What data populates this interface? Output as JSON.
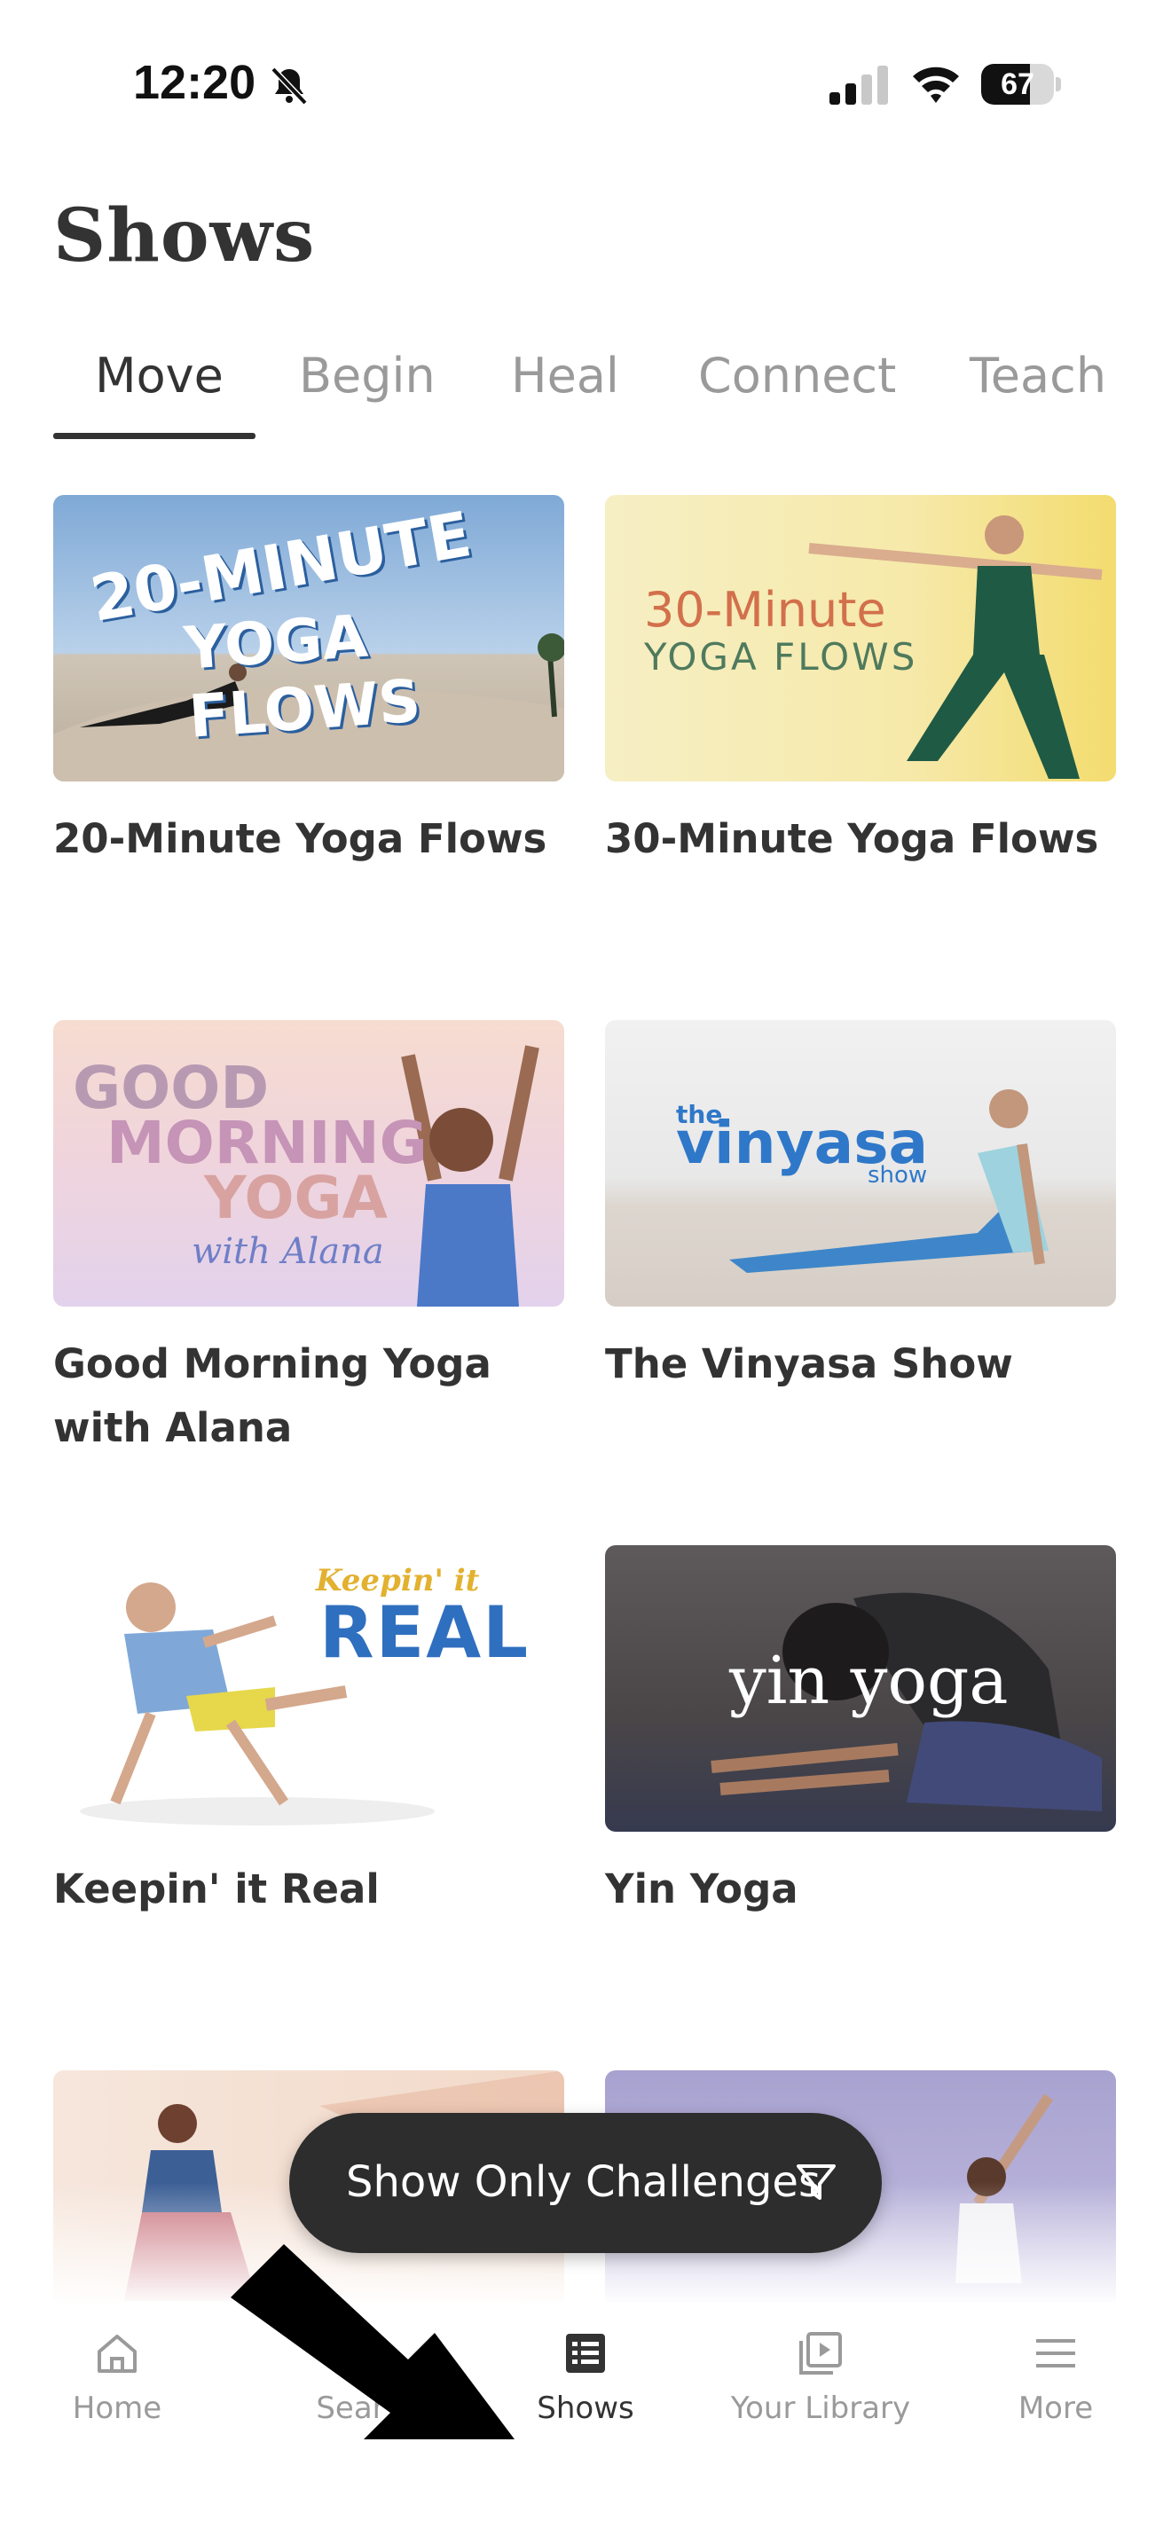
{
  "status": {
    "time": "12:20",
    "battery": "67",
    "battery_level": 0.67
  },
  "page": {
    "title": "Shows"
  },
  "tabs": [
    {
      "label": "Move",
      "active": true
    },
    {
      "label": "Begin",
      "active": false
    },
    {
      "label": "Heal",
      "active": false
    },
    {
      "label": "Connect",
      "active": false
    },
    {
      "label": "Teach",
      "active": false
    }
  ],
  "shows": [
    {
      "title": "20-Minute Yoga Flows",
      "art": [
        "20-MINUTE",
        "YOGA FLOWS"
      ]
    },
    {
      "title": "30-Minute Yoga Flows",
      "art": [
        "30-Minute",
        "YOGA FLOWS"
      ]
    },
    {
      "title": "Good Morning Yoga with Alana",
      "art": [
        "GOOD",
        "MORNING",
        "YOGA",
        "with Alana"
      ]
    },
    {
      "title": "The Vinyasa Show",
      "art": [
        "the",
        "vinyasa",
        "show"
      ]
    },
    {
      "title": "Keepin' it Real",
      "art": [
        "Keepin' it",
        "REAL"
      ]
    },
    {
      "title": "Yin Yoga",
      "art": [
        "yin yoga"
      ]
    }
  ],
  "filter": {
    "label": "Show Only Challenges"
  },
  "tabbar": [
    {
      "label": "Home",
      "icon": "home-icon",
      "active": false
    },
    {
      "label": "Sear",
      "icon": "search-icon",
      "active": false
    },
    {
      "label": "Shows",
      "icon": "shows-icon",
      "active": true
    },
    {
      "label": "Your Library",
      "icon": "library-icon",
      "active": false
    },
    {
      "label": "More",
      "icon": "menu-icon",
      "active": false
    }
  ],
  "colors": {
    "text": "#333333",
    "muted": "#9a9a9a",
    "pill": "#2d2d2d"
  }
}
